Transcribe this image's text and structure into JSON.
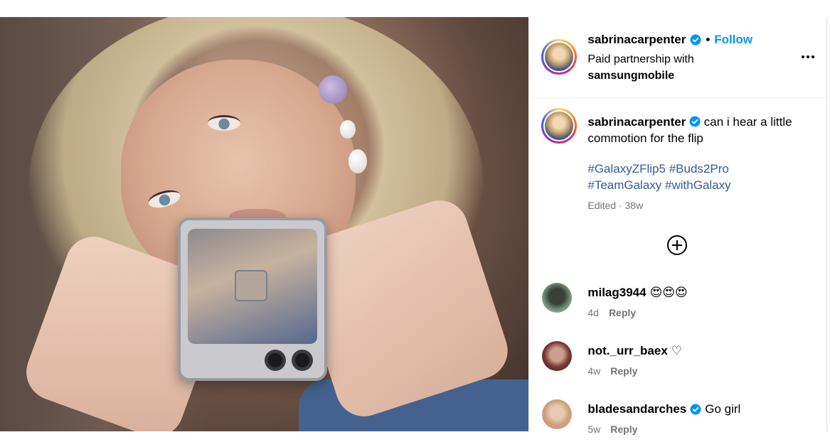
{
  "post": {
    "author": "sabrinacarpenter",
    "follow_label": "Follow",
    "partnership_prefix": "Paid partnership with",
    "partner": "samsungmobile",
    "caption_text": "can i hear a little commotion for the flip",
    "hashtags": [
      "#GalaxyZFlip5",
      "#Buds2Pro",
      "#TeamGalaxy",
      "#withGalaxy"
    ],
    "edited_label": "Edited · 38w",
    "more_icon": "more-options-icon",
    "load_more_icon": "add-circle-icon"
  },
  "comments": [
    {
      "user": "milag3944",
      "text": "😍😍😍",
      "age": "4d",
      "reply_label": "Reply",
      "verified": false
    },
    {
      "user": "not._urr_baex",
      "text": "♡",
      "age": "4w",
      "reply_label": "Reply",
      "verified": false
    },
    {
      "user": "bladesandarches",
      "text": "Go girl",
      "age": "5w",
      "reply_label": "Reply",
      "verified": true
    }
  ],
  "colors": {
    "link_blue": "#0095f6",
    "hashtag_blue": "#385898",
    "muted": "#737373"
  }
}
